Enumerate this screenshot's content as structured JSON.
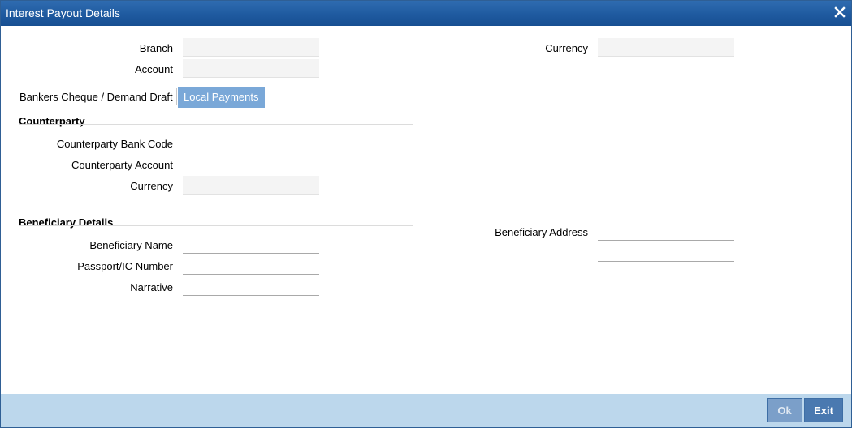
{
  "window": {
    "title": "Interest Payout Details",
    "close_icon": "close-icon"
  },
  "header": {
    "branch_label": "Branch",
    "branch_value": "",
    "account_label": "Account",
    "account_value": "",
    "currency_label": "Currency",
    "currency_value": ""
  },
  "tabs": [
    {
      "label": "Bankers Cheque / Demand Draft",
      "active": false
    },
    {
      "label": "Local Payments",
      "active": true
    }
  ],
  "counterparty": {
    "section_title": "Counterparty",
    "bank_code_label": "Counterparty Bank Code",
    "bank_code_value": "",
    "account_label": "Counterparty Account",
    "account_value": "",
    "currency_label": "Currency",
    "currency_value": ""
  },
  "beneficiary": {
    "section_title": "Beneficiary Details",
    "name_label": "Beneficiary Name",
    "name_value": "",
    "passport_label": "Passport/IC Number",
    "passport_value": "",
    "narrative_label": "Narrative",
    "narrative_value": "",
    "address_label": "Beneficiary Address",
    "address_line1": "",
    "address_line2": ""
  },
  "footer": {
    "ok_label": "Ok",
    "exit_label": "Exit"
  },
  "colors": {
    "titlebar": "#1f5aa0",
    "active_tab": "#7aa8d8",
    "footer": "#bcd7ec",
    "button": "#4a79b0"
  }
}
